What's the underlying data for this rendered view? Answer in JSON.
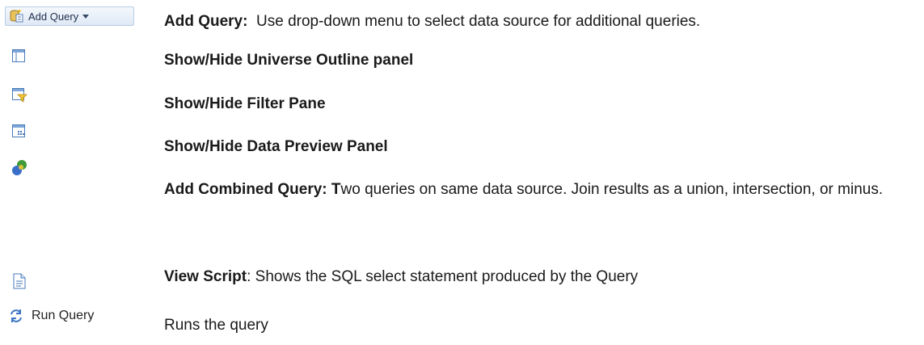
{
  "toolbar": {
    "add_query_label": "Add Query",
    "run_query_label": "Run Query"
  },
  "descriptions": {
    "add_query": {
      "bold": "Add Query:",
      "text": "  Use drop-down menu to select data source for additional queries."
    },
    "universe_outline": {
      "bold": "Show/Hide Universe Outline panel"
    },
    "filter_pane": {
      "bold": "Show/Hide Filter Pane"
    },
    "data_preview": {
      "bold": "Show/Hide Data Preview Panel"
    },
    "combined_query": {
      "bold": "Add Combined Query: T",
      "text": "wo queries on same data source. Join results as a union, intersection, or minus."
    },
    "view_script": {
      "bold": "View Script",
      "text": ": Shows the SQL select statement produced by the Query"
    },
    "run_query": {
      "text": "Runs the query"
    }
  },
  "colors": {
    "button_border": "#b7cde6",
    "icon_blue": "#4a7ab8"
  },
  "icons": [
    "query-add-icon",
    "dropdown-arrow-icon",
    "panel-icon",
    "filter-icon",
    "data-preview-icon",
    "combined-query-icon",
    "script-icon",
    "refresh-icon"
  ]
}
